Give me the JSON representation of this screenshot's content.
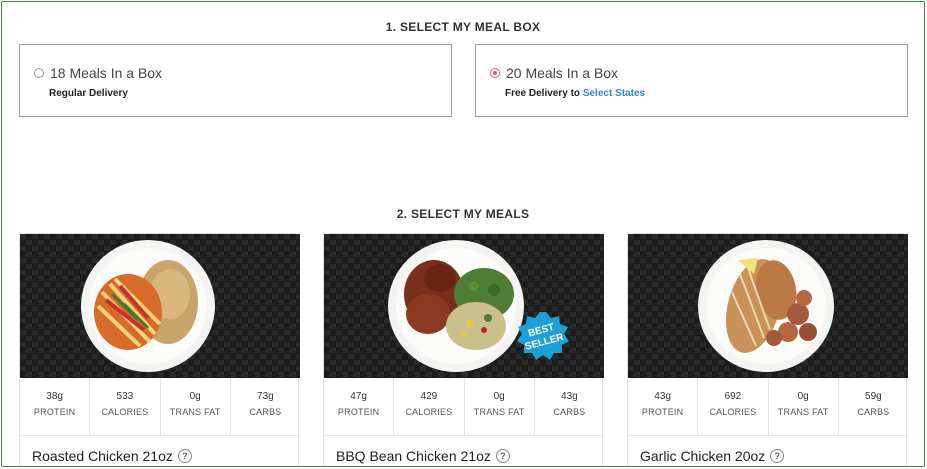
{
  "step1": {
    "title": "1. SELECT MY MEAL BOX",
    "options": [
      {
        "title": "18 Meals In a Box",
        "subtitle": "Regular Delivery",
        "selected": false
      },
      {
        "title": "20 Meals In a Box",
        "subtitle_prefix": "Free Delivery to ",
        "subtitle_link": "Select States",
        "selected": true
      }
    ]
  },
  "step2": {
    "title": "2. SELECT MY MEALS",
    "meals": [
      {
        "name": "Roasted Chicken 21oz",
        "nutrition": [
          {
            "value": "38g",
            "label": "PROTEIN"
          },
          {
            "value": "533",
            "label": "CALORIES"
          },
          {
            "value": "0g",
            "label": "TRANS FAT"
          },
          {
            "value": "73g",
            "label": "CARBS"
          }
        ]
      },
      {
        "name": "BBQ Bean Chicken 21oz",
        "badge": {
          "line1": "BEST",
          "line2": "SELLER"
        },
        "nutrition": [
          {
            "value": "47g",
            "label": "PROTEIN"
          },
          {
            "value": "429",
            "label": "CALORIES"
          },
          {
            "value": "0g",
            "label": "TRANS FAT"
          },
          {
            "value": "43g",
            "label": "CARBS"
          }
        ]
      },
      {
        "name": "Garlic Chicken 20oz",
        "nutrition": [
          {
            "value": "43g",
            "label": "PROTEIN"
          },
          {
            "value": "692",
            "label": "CALORIES"
          },
          {
            "value": "0g",
            "label": "TRANS FAT"
          },
          {
            "value": "59g",
            "label": "CARBS"
          }
        ]
      }
    ]
  },
  "icons": {
    "help": "?"
  },
  "colors": {
    "radio_selected": "#e2557e",
    "link": "#2a8bc8",
    "badge": "#1ea0d6",
    "frame": "#3f8a3f"
  }
}
